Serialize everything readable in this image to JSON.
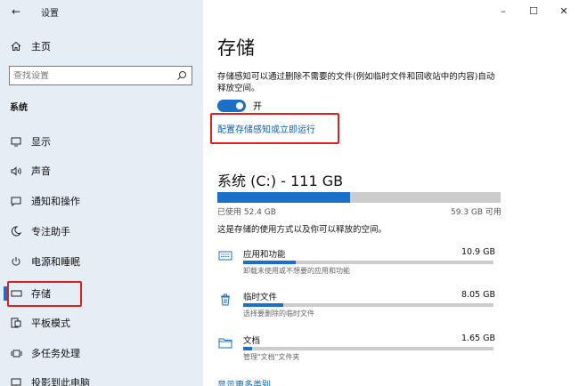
{
  "window": {
    "title": "设置",
    "back": "←",
    "minimize": "–",
    "maximize": "☐",
    "close": "✕"
  },
  "sidebar": {
    "home_label": "主页",
    "search_placeholder": "查找设置",
    "section": "系统",
    "items": [
      {
        "label": "显示",
        "icon": "display-icon"
      },
      {
        "label": "声音",
        "icon": "speaker-icon"
      },
      {
        "label": "通知和操作",
        "icon": "notification-icon"
      },
      {
        "label": "专注助手",
        "icon": "moon-icon"
      },
      {
        "label": "电源和睡眠",
        "icon": "power-icon"
      },
      {
        "label": "存储",
        "icon": "storage-icon",
        "active": true
      },
      {
        "label": "平板模式",
        "icon": "tablet-icon"
      },
      {
        "label": "多任务处理",
        "icon": "multitask-icon"
      },
      {
        "label": "投影到此电脑",
        "icon": "project-icon"
      }
    ]
  },
  "main": {
    "title": "存储",
    "description": "存储感知可以通过删除不需要的文件(例如临时文件和回收站中的内容)自动释放空间。",
    "toggle_label": "开",
    "toggle_on": true,
    "config_link": "配置存储感知或立即运行",
    "drive": {
      "title": "系统 (C:) - 111 GB",
      "used": "已使用 52.4 GB",
      "free": "59.3 GB 可用",
      "used_fraction": 0.47,
      "usage_desc": "这是存储的使用方式以及你可以释放的空间。"
    },
    "categories": [
      {
        "name": "应用和功能",
        "size": "10.9 GB",
        "sub": "卸载未使用或不想要的应用和功能",
        "fraction": 0.21,
        "icon": "keyboard-icon"
      },
      {
        "name": "临时文件",
        "size": "8.05 GB",
        "sub": "选择要删除的临时文件",
        "fraction": 0.16,
        "icon": "trash-icon"
      },
      {
        "name": "文档",
        "size": "1.65 GB",
        "sub": "管理\"文档\"文件夹",
        "fraction": 0.035,
        "icon": "folder-icon"
      }
    ],
    "more_link": "显示更多类别"
  },
  "colors": {
    "accent": "#1a6fc9",
    "highlight": "#e02020",
    "sidebar_bg": "#e6eef5"
  }
}
